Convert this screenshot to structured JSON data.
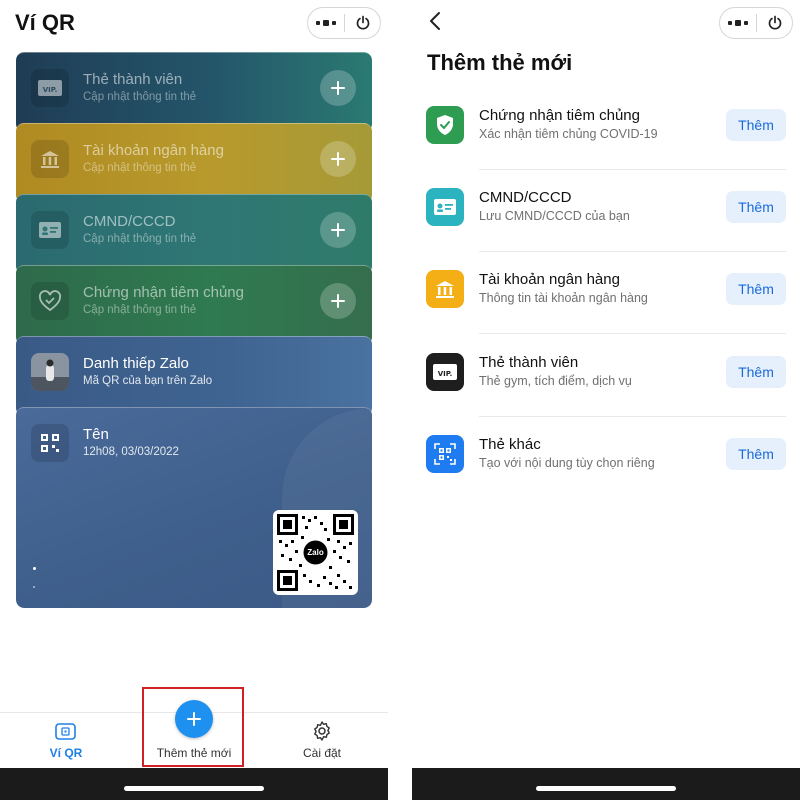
{
  "left": {
    "title": "Ví QR",
    "cards": [
      {
        "title": "Thẻ thành viên",
        "subtitle": "Cập nhật thông tin thẻ",
        "icon": "vip-card-icon"
      },
      {
        "title": "Tài khoản ngân hàng",
        "subtitle": "Cập nhật thông tin thẻ",
        "icon": "bank-icon"
      },
      {
        "title": "CMND/CCCD",
        "subtitle": "Cập nhật thông tin thẻ",
        "icon": "id-card-icon"
      },
      {
        "title": "Chứng nhận tiêm chủng",
        "subtitle": "Cập nhật thông tin thẻ",
        "icon": "heart-shield-icon"
      },
      {
        "title": "Danh thiếp Zalo",
        "subtitle": "Mã QR của bạn trên Zalo",
        "icon": "avatar"
      },
      {
        "title": "Tên",
        "subtitle": "12h08, 03/03/2022",
        "icon": "qr-icon"
      }
    ],
    "qr_logo_text": "Zalo",
    "nav": {
      "wallet_label": "Ví QR",
      "add_label": "Thêm thẻ mới",
      "settings_label": "Cài đặt"
    }
  },
  "right": {
    "title": "Thêm thẻ mới",
    "items": [
      {
        "title": "Chứng nhận tiêm chủng",
        "subtitle": "Xác nhận tiêm chủng COVID-19",
        "button": "Thêm",
        "icon": "shield-check-icon",
        "color": "#2e9d52"
      },
      {
        "title": "CMND/CCCD",
        "subtitle": "Lưu CMND/CCCD của bạn",
        "button": "Thêm",
        "icon": "id-card-icon",
        "color": "#2bb3c0"
      },
      {
        "title": "Tài khoản ngân hàng",
        "subtitle": "Thông tin tài khoản ngân hàng",
        "button": "Thêm",
        "icon": "bank-icon",
        "color": "#f4ae16"
      },
      {
        "title": "Thẻ thành viên",
        "subtitle": "Thẻ gym, tích điểm, dịch vụ",
        "button": "Thêm",
        "icon": "vip-card-icon",
        "color": "#1e1e1e"
      },
      {
        "title": "Thẻ khác",
        "subtitle": "Tạo với nội dung tùy chọn riêng",
        "button": "Thêm",
        "icon": "qr-scan-icon",
        "color": "#1e7bf0"
      }
    ]
  },
  "colors": {
    "accent": "#1e90ef",
    "highlight_border": "#d11f26",
    "add_button_bg": "#e6f0fd",
    "add_button_text": "#1a6ad8"
  }
}
